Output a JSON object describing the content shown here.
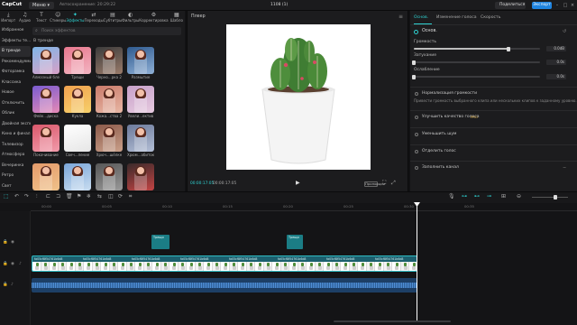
{
  "app": {
    "brand": "CapCut",
    "menu_label": "Меню",
    "autosave": "Автосохранение: 20:29:22",
    "project_title": "1108 (1)",
    "share_label": "Поделиться",
    "export_label": "Экспорт"
  },
  "left_tabs": [
    {
      "label": "Импорт",
      "icon": "import-icon"
    },
    {
      "label": "Аудио",
      "icon": "audio-icon"
    },
    {
      "label": "Текст",
      "icon": "text-icon"
    },
    {
      "label": "Стикеры",
      "icon": "sticker-icon"
    },
    {
      "label": "Эффекты",
      "icon": "effects-icon",
      "active": true
    },
    {
      "label": "Переходы",
      "icon": "transitions-icon"
    },
    {
      "label": "Субтитры",
      "icon": "captions-icon"
    },
    {
      "label": "Фильтры",
      "icon": "filters-icon"
    },
    {
      "label": "Корректировка",
      "icon": "adjust-icon"
    },
    {
      "label": "Шабло",
      "icon": "template-icon"
    }
  ],
  "categories": [
    "Избранное",
    "Эффекты те...",
    "В тренде",
    "Рекомендуемые",
    "Фоторамка",
    "Классика",
    "Новое",
    "Отключить",
    "Облик",
    "Двойная экспозиция",
    "Кино и финал",
    "Телевизор",
    "Атмосфера",
    "Вечеринка",
    "Ретро",
    "Свет",
    "Пленка",
    "Искажение",
    "Размытие",
    "Эффекты те..."
  ],
  "search": {
    "placeholder": "Поиск эффектов"
  },
  "section_title": "В тренде",
  "effects": [
    {
      "name": "Алмазный бле",
      "colors": [
        "#7fb6e8",
        "#d8a1c7"
      ]
    },
    {
      "name": "Трещи",
      "colors": [
        "#e8788e",
        "#f3b5c2"
      ]
    },
    {
      "name": "Черно...рка 2",
      "colors": [
        "#3b3b3b",
        "#9a7b6a"
      ]
    },
    {
      "name": "Размытие",
      "colors": [
        "#2f5a8f",
        "#8fb0d6"
      ]
    },
    {
      "name": "Фейк...диска",
      "colors": [
        "#7a5bd0",
        "#e68ab6"
      ]
    },
    {
      "name": "Кукла",
      "colors": [
        "#f0a24f",
        "#f7d06a"
      ]
    },
    {
      "name": "Кожа...ства 2",
      "colors": [
        "#c97a6a",
        "#e8b7a5"
      ]
    },
    {
      "name": "Увели...ектив",
      "colors": [
        "#c7a0c9",
        "#e7cbe0"
      ]
    },
    {
      "name": "Покачивание",
      "colors": [
        "#d9586b",
        "#f29bab"
      ]
    },
    {
      "name": "Свеч...ление",
      "colors": [
        "#ffffff",
        "#e6e6e6"
      ]
    },
    {
      "name": "Хрюч...шёлке",
      "colors": [
        "#8c5a4a",
        "#caa08a"
      ]
    },
    {
      "name": "Хрюм...абиток",
      "colors": [
        "#6c7a9b",
        "#b4bfd6"
      ]
    },
    {
      "name": "Мини-сгм",
      "colors": [
        "#e39a6a",
        "#f0c28a"
      ]
    },
    {
      "name": "Пенер...й дух",
      "colors": [
        "#7aa6d9",
        "#c9ddf0"
      ]
    },
    {
      "name": "Рисса...кость",
      "colors": [
        "#565656",
        "#9a9a9a"
      ]
    },
    {
      "name": "Крест...ебеки",
      "colors": [
        "#3a2a2a",
        "#c44444"
      ]
    }
  ],
  "preview": {
    "title": "Плеер",
    "time_current": "00:00:17:05",
    "time_total": "00:00:17:05",
    "ratio_label": "Пропорции"
  },
  "right_tabs": [
    {
      "label": "Основ.",
      "active": true
    },
    {
      "label": "Изменение голоса"
    },
    {
      "label": "Скорость"
    }
  ],
  "basic": {
    "section": "Основ.",
    "sliders": [
      {
        "label": "Громкость",
        "value": "0.0dB",
        "level": 0.75
      },
      {
        "label": "Затухание",
        "value": "0.0s",
        "level": 0.0
      },
      {
        "label": "Ослабление",
        "value": "0.0s",
        "level": 0.0
      }
    ],
    "options": [
      {
        "label": "Нормализация громкости",
        "desc": "Привести громкость выбранного клипа или нескольких клипов к заданному уровню."
      },
      {
        "label": "Улучшить качество голоса",
        "badge": "PRO"
      },
      {
        "label": "Уменьшить шум"
      },
      {
        "label": "Отделить голос"
      },
      {
        "label": "Заполнить канал"
      }
    ]
  },
  "ruler_ticks": [
    "00:00",
    "00:05",
    "00:10",
    "00:15",
    "00:20",
    "00:25",
    "00:30",
    "00:35"
  ],
  "fx_clips": [
    {
      "label": "Трещи"
    },
    {
      "label": "Трещи"
    }
  ],
  "video_clip": {
    "labels": [
      "fa05cf8f54761b6d8",
      "fa05cf8f54761b6d8",
      "fa05cf8f54761b6d8",
      "fa05cf8f54761b6d8",
      "fa05cf8f54761b6d8",
      "fa05cf8f54761b6d8",
      "fa05cf8f54761b6d8",
      "fa05cf8f54761b6d8"
    ],
    "frame_count": 45
  },
  "audio_clip": {
    "label": ""
  },
  "colors": {
    "accent": "#2fd3d3",
    "export": "#1f84e0",
    "bg": "#111113"
  }
}
